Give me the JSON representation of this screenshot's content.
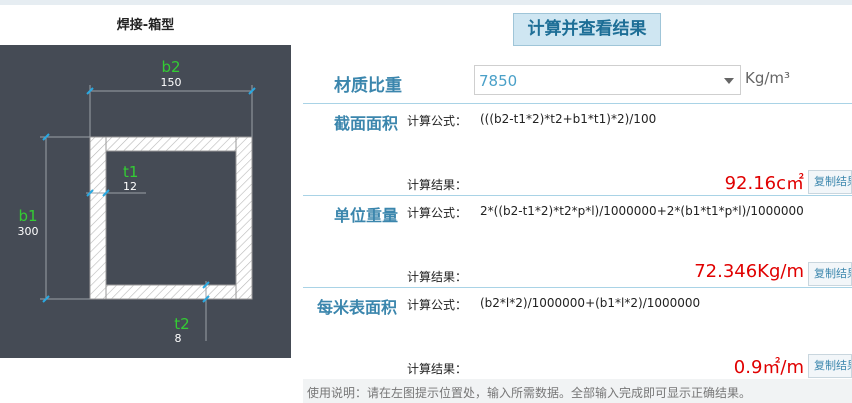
{
  "left_panel": {
    "title": "焊接-箱型",
    "dims": {
      "b2": {
        "name": "b2",
        "value": "150"
      },
      "b1": {
        "name": "b1",
        "value": "300"
      },
      "t1": {
        "name": "t1",
        "value": "12"
      },
      "t2": {
        "name": "t2",
        "value": "8"
      }
    }
  },
  "header": {
    "calc_button": "计算并查看结果"
  },
  "material": {
    "label": "材质比重",
    "value": "7850",
    "unit": "Kg/m³"
  },
  "sections": [
    {
      "title": "截面面积",
      "formula_label": "计算公式：",
      "formula": "(((b2-t1*2)*t2+b1*t1)*2)/100",
      "result_label": "计算结果：",
      "result": "92.16c㎡",
      "copy_label": "复制结果"
    },
    {
      "title": "单位重量",
      "formula_label": "计算公式：",
      "formula": "2*((b2-t1*2)*t2*p*l)/1000000+2*(b1*t1*p*l)/1000000",
      "result_label": "计算结果：",
      "result": "72.346Kg/m",
      "copy_label": "复制结果"
    },
    {
      "title": "每米表面积",
      "formula_label": "计算公式：",
      "formula": "(b2*l*2)/1000000+(b1*l*2)/1000000",
      "result_label": "计算结果：",
      "result": "0.9㎡/m",
      "copy_label": "复制结果"
    }
  ],
  "footer": {
    "note": "使用说明：请在左图提示位置处，输入所需数据。全部输入完成即可显示正确结果。"
  },
  "colors": {
    "accent": "#3b86ad",
    "result": "#e00000",
    "dim_name": "#33cc33",
    "diagram_bg": "#454b55"
  }
}
